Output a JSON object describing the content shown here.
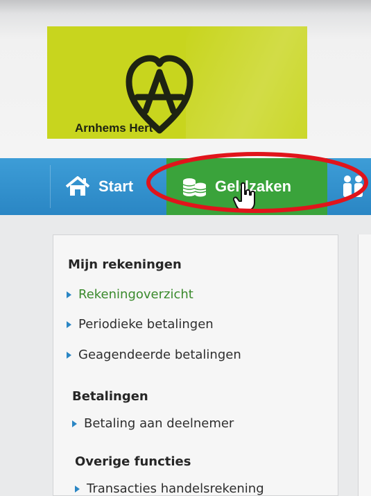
{
  "brand": {
    "name": "Arnhems Hert",
    "logo_color": "#c8d51e"
  },
  "nav": {
    "items": [
      {
        "label": "Start",
        "icon": "home-icon"
      },
      {
        "label": "Geldzaken",
        "icon": "coins-icon",
        "active": true
      },
      {
        "label": "",
        "icon": "people-icon"
      }
    ],
    "bar_color": "#2a86c4",
    "active_color": "#3aa33b"
  },
  "annotation": {
    "color": "#e0141b"
  },
  "menu": {
    "sections": [
      {
        "heading": "Mijn rekeningen",
        "items": [
          "Rekeningoverzicht",
          "Periodieke betalingen",
          "Geagendeerde betalingen"
        ]
      },
      {
        "heading": "Betalingen",
        "items": [
          "Betaling aan deelnemer"
        ]
      },
      {
        "heading": "Overige functies",
        "items": [
          "Transacties handelsrekening"
        ]
      }
    ],
    "active_item": "Rekeningoverzicht"
  }
}
